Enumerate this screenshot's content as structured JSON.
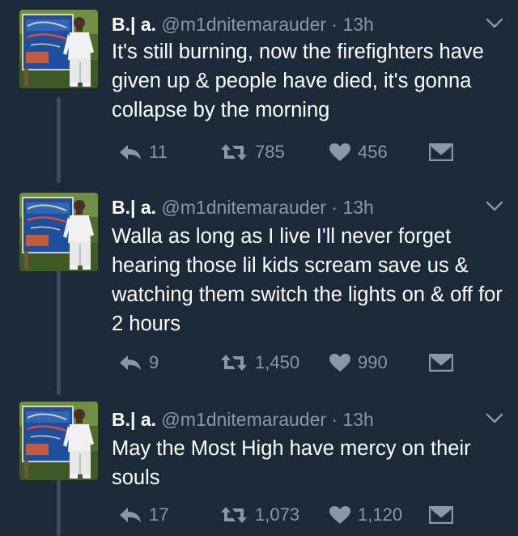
{
  "colors": {
    "background": "#1c2938",
    "text": "#ffffff",
    "muted": "#8899a6",
    "thread_line": "#3a4c5f"
  },
  "tweets": [
    {
      "name": "B.| a.",
      "handle": "@m1dnitemarauder",
      "separator": "·",
      "time": "13h",
      "text": "It's still burning, now the firefighters have given up & people have died, it's gonna collapse by the morning",
      "replies": "11",
      "retweets": "785",
      "likes": "456",
      "icons": [
        "reply-icon",
        "retweet-icon",
        "like-icon",
        "dm-icon",
        "chevron-down-icon"
      ]
    },
    {
      "name": "B.| a.",
      "handle": "@m1dnitemarauder",
      "separator": "·",
      "time": "13h",
      "text": "Walla as long as I live I'll never forget hearing those lil kids scream save us & watching them switch the lights on & off for 2 hours",
      "replies": "9",
      "retweets": "1,450",
      "likes": "990",
      "icons": [
        "reply-icon",
        "retweet-icon",
        "like-icon",
        "dm-icon",
        "chevron-down-icon"
      ]
    },
    {
      "name": "B.| a.",
      "handle": "@m1dnitemarauder",
      "separator": "·",
      "time": "13h",
      "text": "May the Most High have mercy on their souls",
      "replies": "17",
      "retweets": "1,073",
      "likes": "1,120",
      "icons": [
        "reply-icon",
        "retweet-icon",
        "like-icon",
        "dm-icon",
        "chevron-down-icon"
      ]
    }
  ]
}
